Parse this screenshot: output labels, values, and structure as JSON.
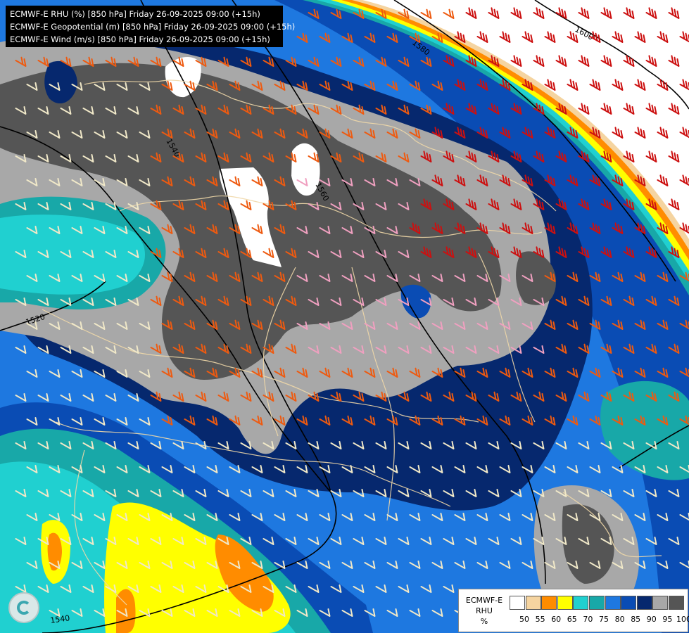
{
  "header": {
    "line1": "ECMWF-E RHU (%) [850 hPa] Friday 26-09-2025 09:00 (+15h)",
    "line2": "ECMWF-E Geopotential (m) [850 hPa] Friday 26-09-2025 09:00 (+15h)",
    "line3": "ECMWF-E Wind (m/s) [850 hPa] Friday 26-09-2025 09:00 (+15h)"
  },
  "legend": {
    "title1": "ECMWF-E",
    "title2": "RHU",
    "title3": "%",
    "bins": [
      {
        "label": "50",
        "color": "#ffffff"
      },
      {
        "label": "55",
        "color": "#f5d4a0"
      },
      {
        "label": "60",
        "color": "#ff8c00"
      },
      {
        "label": "65",
        "color": "#ffff00"
      },
      {
        "label": "70",
        "color": "#20d0d0"
      },
      {
        "label": "75",
        "color": "#18a8a8"
      },
      {
        "label": "80",
        "color": "#1e78e0"
      },
      {
        "label": "85",
        "color": "#0a4cb4"
      },
      {
        "label": "90",
        "color": "#06286e"
      },
      {
        "label": "95",
        "color": "#a8a8a8"
      },
      {
        "label": "100",
        "color": "#555555"
      }
    ]
  },
  "contours": [
    "1520",
    "1540",
    "1560",
    "1580",
    "1600",
    "1540"
  ],
  "colors": {
    "wind_red": "#cc1010",
    "wind_orange": "#ee5a10",
    "wind_pink": "#f0a0c0",
    "wind_light": "#f0e8c8",
    "borders": "#f0d8a8"
  },
  "icons": [
    "ecmwf-logo-icon"
  ]
}
